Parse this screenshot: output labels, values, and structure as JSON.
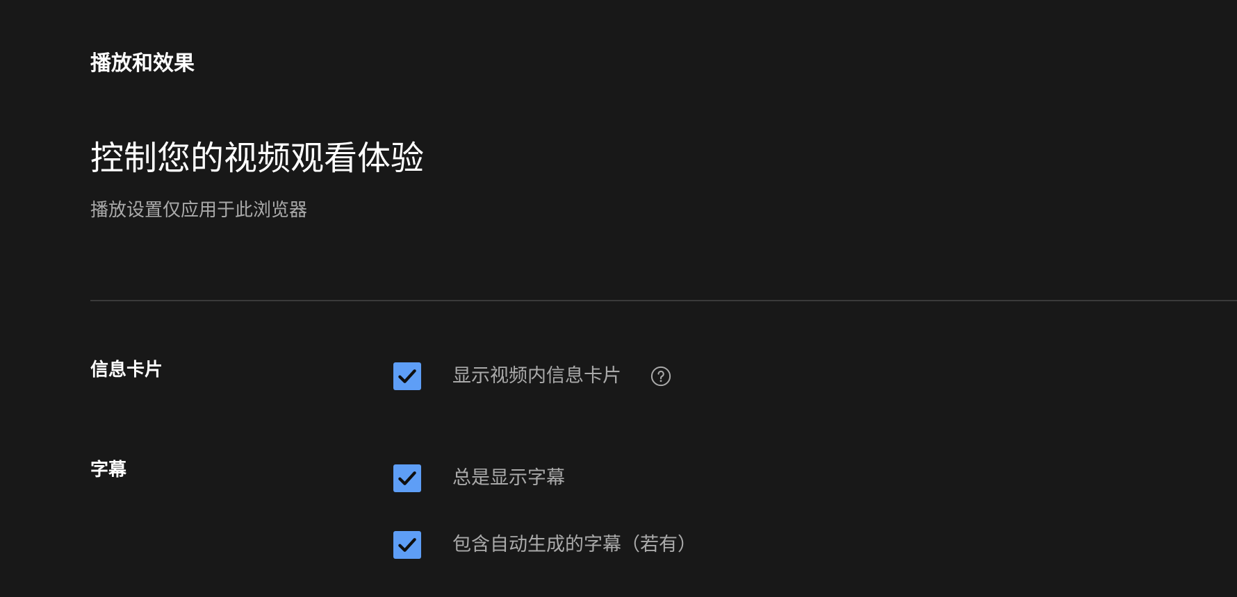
{
  "header": {
    "section_title": "播放和效果",
    "heading": "控制您的视频观看体验",
    "subtitle": "播放设置仅应用于此浏览器"
  },
  "settings": {
    "info_cards": {
      "label": "信息卡片",
      "options": [
        {
          "label": "显示视频内信息卡片",
          "checked": true,
          "help_icon": "help-circle-icon"
        }
      ]
    },
    "captions": {
      "label": "字幕",
      "options": [
        {
          "label": "总是显示字幕",
          "checked": true
        },
        {
          "label": "包含自动生成的字幕（若有）",
          "checked": true
        }
      ]
    }
  },
  "colors": {
    "background": "#181818",
    "checkbox": "#5e9ef6",
    "checkmark": "#0f0f0f",
    "secondary_text": "#aaaaaa",
    "divider": "#3a3a3a"
  }
}
